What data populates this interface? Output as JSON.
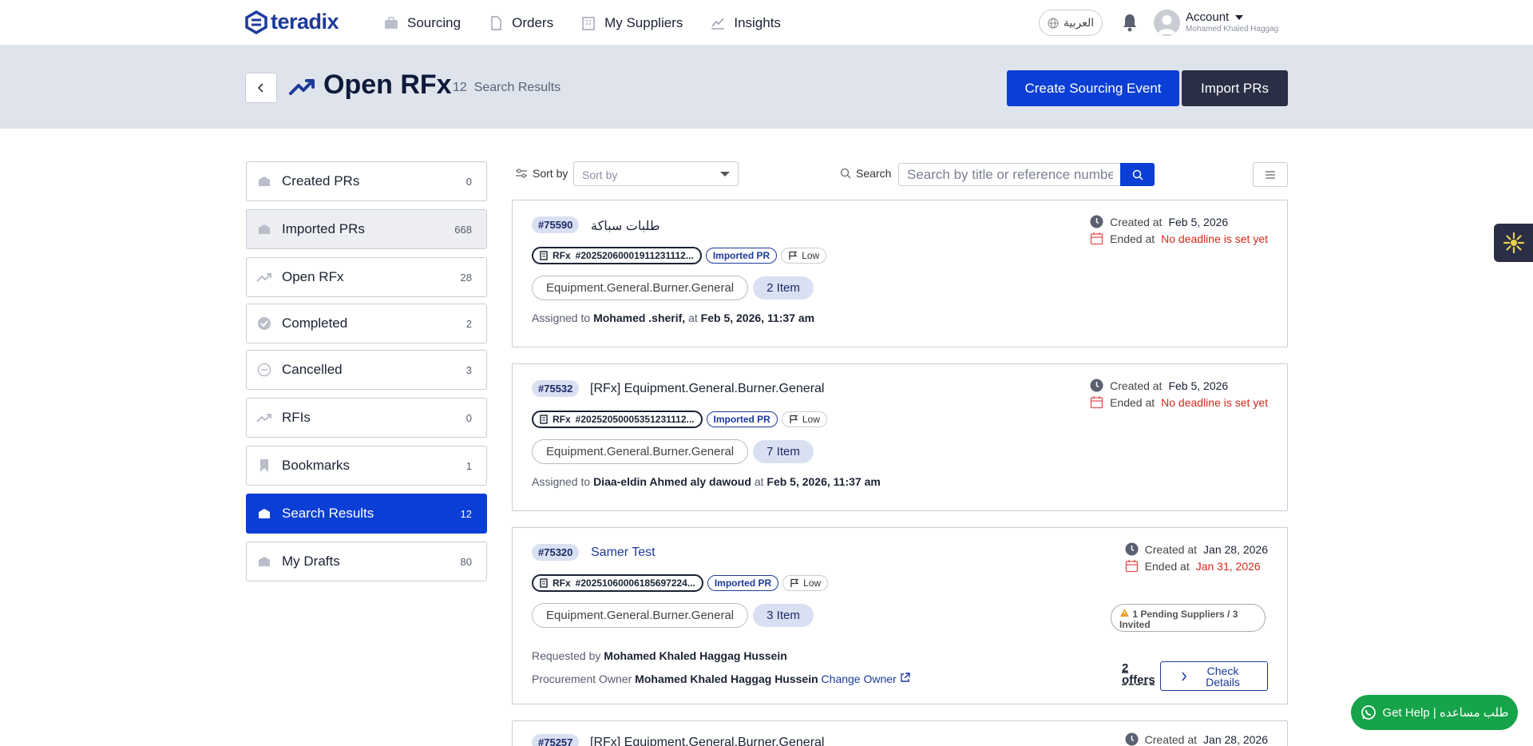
{
  "nav": {
    "logo": "teradix",
    "links": [
      {
        "label": "Sourcing",
        "icon": "briefcase-icon"
      },
      {
        "label": "Orders",
        "icon": "document-icon"
      },
      {
        "label": "My Suppliers",
        "icon": "building-icon"
      },
      {
        "label": "Insights",
        "icon": "chart-line-icon"
      }
    ],
    "language": "العربية",
    "account_label": "Account",
    "account_name": "Mohamed Khaled Haggag"
  },
  "hero": {
    "title": "Open RFx",
    "count": "12",
    "count_label": "Search Results",
    "create_label": "Create Sourcing Event",
    "import_label": "Import PRs"
  },
  "sidebar": [
    {
      "label": "Created PRs",
      "count": "0"
    },
    {
      "label": "Imported PRs",
      "count": "668"
    },
    {
      "label": "Open RFx",
      "count": "28"
    },
    {
      "label": "Completed",
      "count": "2"
    },
    {
      "label": "Cancelled",
      "count": "3"
    },
    {
      "label": "RFIs",
      "count": "0"
    },
    {
      "label": "Bookmarks",
      "count": "1"
    },
    {
      "label": "Search Results",
      "count": "12"
    },
    {
      "label": "My Drafts",
      "count": "80"
    }
  ],
  "toolbar": {
    "sort_label": "Sort by",
    "sort_placeholder": "Sort by",
    "search_label": "Search",
    "search_placeholder": "Search by title or reference number"
  },
  "cards": [
    {
      "ref": "#75590",
      "title": "طلبات سباكة",
      "rfx_label": "RFx",
      "rfx_number": "#20252060001911231112...",
      "imported": "Imported PR",
      "priority": "Low",
      "category": "Equipment.General.Burner.General",
      "items": "2 Item",
      "assigned_prefix": "Assigned to",
      "assignee": "Mohamed .sherif,",
      "at": "at",
      "assigned_time": "Feb 5, 2026, 11:37 am",
      "created_label": "Created at",
      "created": "Feb 5, 2026",
      "ended_label": "Ended at",
      "ended": "No deadline is set yet"
    },
    {
      "ref": "#75532",
      "title": "[RFx] Equipment.General.Burner.General",
      "rfx_label": "RFx",
      "rfx_number": "#20252050005351231112...",
      "imported": "Imported PR",
      "priority": "Low",
      "category": "Equipment.General.Burner.General",
      "items": "7 Item",
      "assigned_prefix": "Assigned to",
      "assignee": "Diaa-eldin Ahmed aly dawoud",
      "at": "at",
      "assigned_time": "Feb 5, 2026, 11:37 am",
      "created_label": "Created at",
      "created": "Feb 5, 2026",
      "ended_label": "Ended at",
      "ended": "No deadline is set yet"
    },
    {
      "ref": "#75320",
      "title": "Samer Test",
      "rfx_label": "RFx",
      "rfx_number": "#20251060006185697224...",
      "imported": "Imported PR",
      "priority": "Low",
      "category": "Equipment.General.Burner.General",
      "items": "3 Item",
      "requested_label": "Requested by",
      "requested_by": "Mohamed Khaled Haggag Hussein",
      "owner_label": "Procurement Owner",
      "owner": "Mohamed Khaled Haggag Hussein",
      "change_owner": "Change Owner",
      "pending": "1 Pending Suppliers / 3 Invited",
      "offers": "2 offers",
      "check_details": "Check Details",
      "created_label": "Created at",
      "created": "Jan 28, 2026",
      "ended_label": "Ended at",
      "ended": "Jan 31, 2026"
    },
    {
      "ref": "#75257",
      "title": "[RFx] Equipment.General.Burner.General",
      "created_label": "Created at",
      "created": "Jan 28, 2026"
    }
  ],
  "help": {
    "label": "Get Help | طلب مساعده"
  }
}
